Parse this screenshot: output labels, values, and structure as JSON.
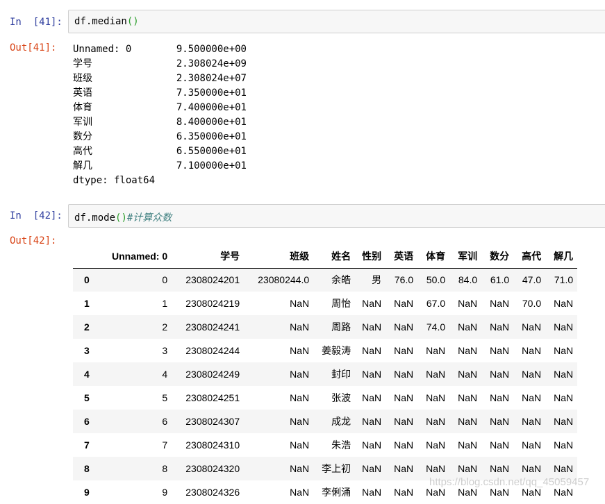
{
  "cells": [
    {
      "in_prompt": "In  [41]:",
      "code": "df.median",
      "code_parens": "()",
      "comment": "",
      "out_prompt": "Out[41]:"
    },
    {
      "in_prompt": "In  [42]:",
      "code": "df.mode",
      "code_parens": "()",
      "comment": "#计算众数",
      "out_prompt": "Out[42]:"
    }
  ],
  "median_output": {
    "rows": [
      {
        "key": "Unnamed: 0",
        "value": "9.500000e+00"
      },
      {
        "key": "学号",
        "value": "2.308024e+09"
      },
      {
        "key": "班级",
        "value": "2.308024e+07"
      },
      {
        "key": "英语",
        "value": "7.350000e+01"
      },
      {
        "key": "体育",
        "value": "7.400000e+01"
      },
      {
        "key": "军训",
        "value": "8.400000e+01"
      },
      {
        "key": "数分",
        "value": "6.350000e+01"
      },
      {
        "key": "高代",
        "value": "6.550000e+01"
      },
      {
        "key": "解几",
        "value": "7.100000e+01"
      }
    ],
    "dtype": "dtype: float64"
  },
  "mode_table": {
    "columns": [
      "",
      "Unnamed: 0",
      "学号",
      "班级",
      "姓名",
      "性别",
      "英语",
      "体育",
      "军训",
      "数分",
      "高代",
      "解几"
    ],
    "rows": [
      [
        "0",
        "0",
        "2308024201",
        "23080244.0",
        "余皓",
        "男",
        "76.0",
        "50.0",
        "84.0",
        "61.0",
        "47.0",
        "71.0"
      ],
      [
        "1",
        "1",
        "2308024219",
        "NaN",
        "周怡",
        "NaN",
        "NaN",
        "67.0",
        "NaN",
        "NaN",
        "70.0",
        "NaN"
      ],
      [
        "2",
        "2",
        "2308024241",
        "NaN",
        "周路",
        "NaN",
        "NaN",
        "74.0",
        "NaN",
        "NaN",
        "NaN",
        "NaN"
      ],
      [
        "3",
        "3",
        "2308024244",
        "NaN",
        "姜毅涛",
        "NaN",
        "NaN",
        "NaN",
        "NaN",
        "NaN",
        "NaN",
        "NaN"
      ],
      [
        "4",
        "4",
        "2308024249",
        "NaN",
        "封印",
        "NaN",
        "NaN",
        "NaN",
        "NaN",
        "NaN",
        "NaN",
        "NaN"
      ],
      [
        "5",
        "5",
        "2308024251",
        "NaN",
        "张波",
        "NaN",
        "NaN",
        "NaN",
        "NaN",
        "NaN",
        "NaN",
        "NaN"
      ],
      [
        "6",
        "6",
        "2308024307",
        "NaN",
        "成龙",
        "NaN",
        "NaN",
        "NaN",
        "NaN",
        "NaN",
        "NaN",
        "NaN"
      ],
      [
        "7",
        "7",
        "2308024310",
        "NaN",
        "朱浩",
        "NaN",
        "NaN",
        "NaN",
        "NaN",
        "NaN",
        "NaN",
        "NaN"
      ],
      [
        "8",
        "8",
        "2308024320",
        "NaN",
        "李上初",
        "NaN",
        "NaN",
        "NaN",
        "NaN",
        "NaN",
        "NaN",
        "NaN"
      ],
      [
        "9",
        "9",
        "2308024326",
        "NaN",
        "李俐涌",
        "NaN",
        "NaN",
        "NaN",
        "NaN",
        "NaN",
        "NaN",
        "NaN"
      ]
    ]
  },
  "watermark": "https://blog.csdn.net/qq_45059457"
}
